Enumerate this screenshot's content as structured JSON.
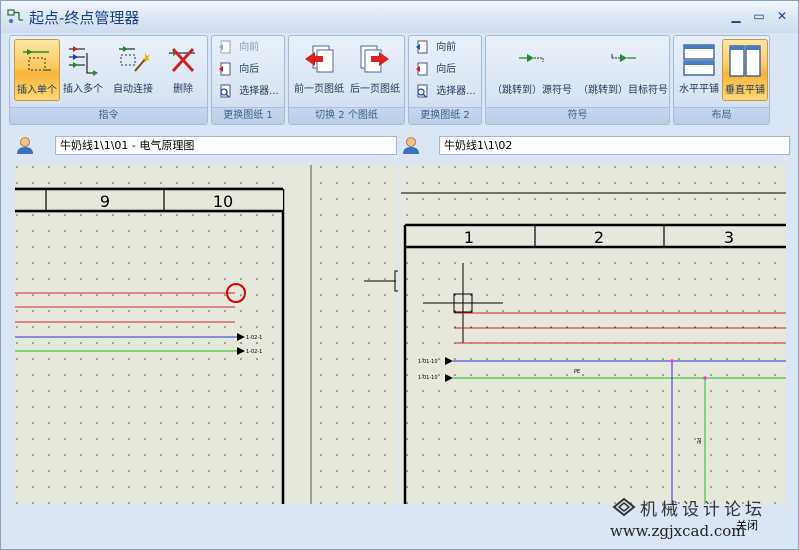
{
  "window": {
    "title": "起点-终点管理器",
    "controls": [
      "minimize",
      "maximize",
      "close"
    ]
  },
  "ribbon": {
    "groups": [
      {
        "label": "指令",
        "buttons": [
          {
            "label": "插入单个",
            "icon": "insert-single-icon",
            "active": true
          },
          {
            "label": "插入多个",
            "icon": "insert-multiple-icon"
          },
          {
            "label": "自动连接",
            "icon": "auto-connect-icon"
          },
          {
            "label": "删除",
            "icon": "delete-icon"
          }
        ]
      },
      {
        "label": "更换图纸 1",
        "buttons": [
          {
            "label": "向前",
            "icon": "forward-icon",
            "disabled": true
          },
          {
            "label": "向后",
            "icon": "backward-icon"
          },
          {
            "label": "选择器...",
            "icon": "selector-icon"
          }
        ]
      },
      {
        "label": "切换 2 个图纸",
        "buttons": [
          {
            "label": "前一页图纸",
            "icon": "previous-page-icon"
          },
          {
            "label": "后一页图纸",
            "icon": "next-page-icon"
          }
        ]
      },
      {
        "label": "更换图纸 2",
        "buttons": [
          {
            "label": "向前",
            "icon": "forward-icon"
          },
          {
            "label": "向后",
            "icon": "backward-icon"
          },
          {
            "label": "选择器...",
            "icon": "selector-icon"
          }
        ]
      },
      {
        "label": "符号",
        "buttons": [
          {
            "label": "（跳转到）源符号",
            "icon": "source-symbol-icon"
          },
          {
            "label": "（跳转到）目标符号",
            "icon": "target-symbol-icon"
          }
        ]
      },
      {
        "label": "布局",
        "buttons": [
          {
            "label": "水平平铺",
            "icon": "tile-horizontal-icon"
          },
          {
            "label": "垂直平铺",
            "icon": "tile-vertical-icon",
            "active": true
          }
        ]
      }
    ]
  },
  "left_pane": {
    "path": "牛奶线1\\1\\01 - 电气原理图",
    "columns": [
      "9",
      "10"
    ],
    "wire_labels": [
      "1-02-1",
      "1-02-1"
    ]
  },
  "right_pane": {
    "path": "牛奶线1\\1\\02",
    "columns": [
      "1",
      "2",
      "3"
    ],
    "wire_labels": [
      "1-01-10",
      "1-01-10"
    ],
    "pe_labels": [
      "PE",
      "PE"
    ]
  },
  "watermark": {
    "title": "机械设计论坛",
    "url": "www.zgjxcad.com"
  },
  "footer": {
    "close_label": "关闭"
  },
  "colors": {
    "canvas": "#e7e8dc",
    "red_wire": "#cc2222",
    "blue_wire": "#2233cc",
    "green_wire": "#22bb22",
    "active_button": "#fbc95d"
  }
}
